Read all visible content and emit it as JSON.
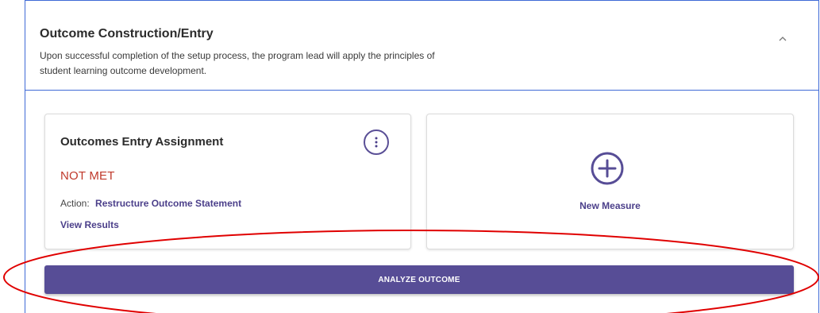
{
  "section": {
    "title": "Outcome Construction/Entry",
    "description": "Upon successful completion of the setup process, the program lead will apply the principles of student learning outcome development.",
    "collapse_icon": "chevron-up-icon"
  },
  "assignment_card": {
    "title": "Outcomes Entry Assignment",
    "menu_icon": "kebab-menu-icon",
    "status": "NOT MET",
    "action_label": "Action:",
    "action_value": "Restructure Outcome Statement",
    "view_results": "View Results"
  },
  "new_measure_card": {
    "icon": "plus-circle-icon",
    "label": "New Measure"
  },
  "analyze_button": {
    "label": "ANALYZE OUTCOME"
  },
  "colors": {
    "accent": "#574d96",
    "link": "#4b3f8a",
    "status_not_met": "#c0392b",
    "panel_border": "#3f6ad6",
    "annotation": "#e00000"
  }
}
